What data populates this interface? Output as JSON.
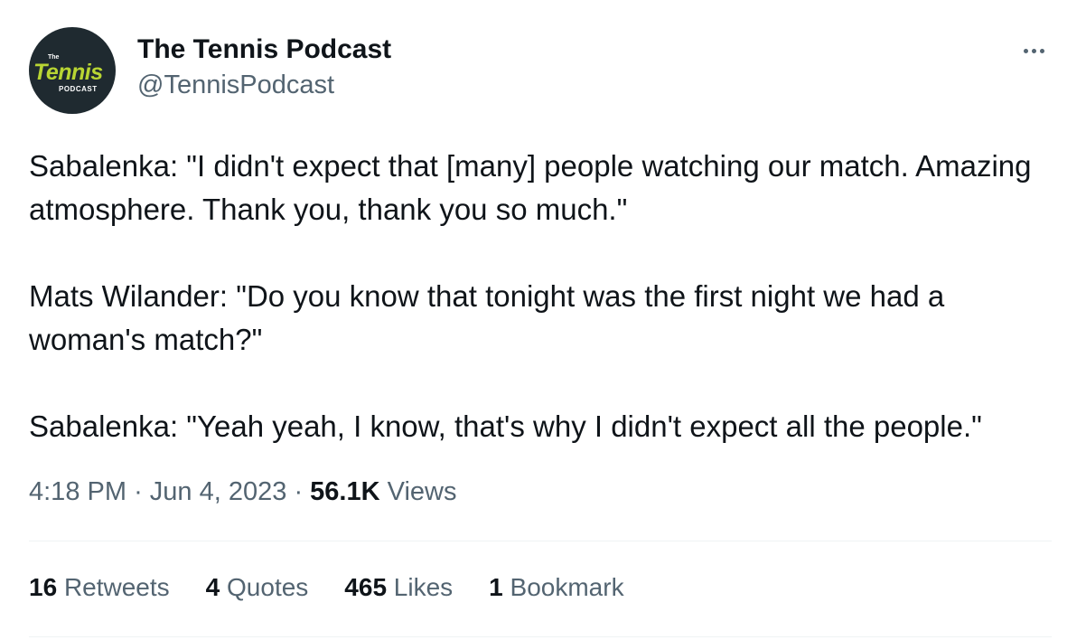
{
  "author": {
    "display_name": "The Tennis Podcast",
    "handle": "@TennisPodcast",
    "avatar_logo": {
      "line1": "The",
      "line2": "Tennis",
      "line3": "PODCAST"
    }
  },
  "more_icon": "more-horizontal-icon",
  "tweet": {
    "paragraphs": [
      "Sabalenka: \"I didn't expect that [many] people watching our match. Amazing atmosphere. Thank you, thank you so much.\"",
      "Mats Wilander: \"Do you know that tonight was the first night we had a woman's match?\"",
      "Sabalenka: \"Yeah yeah, I know, that's why I didn't expect all the people.\""
    ]
  },
  "meta": {
    "time": "4:18 PM",
    "separator": "·",
    "date": "Jun 4, 2023",
    "views_count": "56.1K",
    "views_label": "Views"
  },
  "stats": {
    "retweets": {
      "count": "16",
      "label": "Retweets"
    },
    "quotes": {
      "count": "4",
      "label": "Quotes"
    },
    "likes": {
      "count": "465",
      "label": "Likes"
    },
    "bookmarks": {
      "count": "1",
      "label": "Bookmark"
    }
  },
  "colors": {
    "text_primary": "#0f1419",
    "text_secondary": "#536471",
    "divider": "#eff3f4",
    "avatar_bg": "#1f2a30",
    "logo_accent": "#b8d533"
  }
}
